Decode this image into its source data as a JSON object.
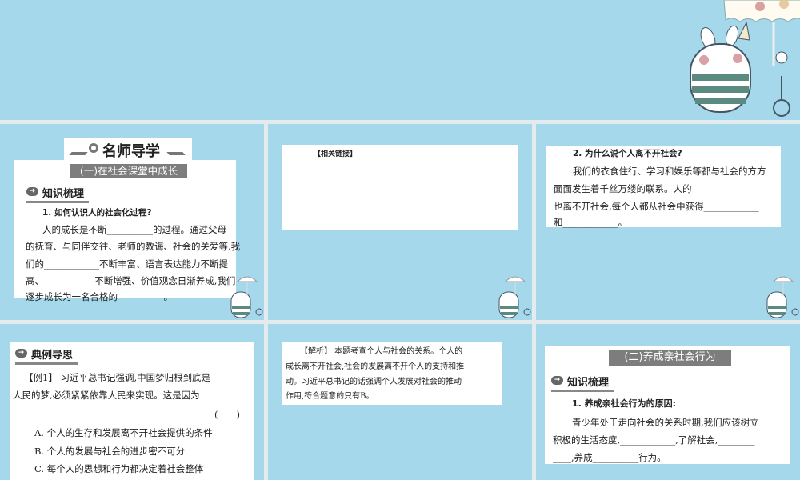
{
  "slide1": {
    "banner": "名师导学",
    "subtitle": "(一)在社会课堂中成长",
    "section": "知识梳理",
    "question": "1. 如何认识人的社会化过程?",
    "lines": [
      "人的成长是不断__________的过程。通过父母",
      "的抚育、与同伴交往、老师的教诲、社会的关爱等,我",
      "们的____________不断丰富、语言表达能力不断提",
      "高、___________不断增强、价值观念日渐养成,我们",
      "逐步成长为一名合格的__________。"
    ]
  },
  "slide2": {
    "label": "【相关链接】"
  },
  "slide3": {
    "question": "2. 为什么说个人离不开社会?",
    "lines": [
      "我们的衣食住行、学习和娱乐等都与社会的方方",
      "面面发生着千丝万缕的联系。人的______________",
      "也离不开社会,每个人都从社会中获得____________",
      "和____________。"
    ]
  },
  "slide4": {
    "section": "典例导思",
    "lines": [
      "【例1】 习近平总书记强调,中国梦归根到底是",
      "人民的梦,必须紧紧依靠人民来实现。这是因为",
      "(　　)"
    ],
    "options": [
      "A. 个人的生存和发展离不开社会提供的条件",
      "B. 个人的发展与社会的进步密不可分",
      "C. 每个人的思想和行为都决定着社会整体"
    ]
  },
  "slide5": {
    "lines": [
      "【解析】 本题考查个人与社会的关系。个人的",
      "成长离不开社会,社会的发展离不开个人的支持和推",
      "动。习近平总书记的话强调个人发展对社会的推动",
      "作用,符合题意的只有B。"
    ]
  },
  "slide6": {
    "subtitle": "(二)养成亲社会行为",
    "section": "知识梳理",
    "question": "1. 养成亲社会行为的原因:",
    "lines": [
      "青少年处于走向社会的关系时期,我们应该树立",
      "积极的生活态度,____________,了解社会,________",
      "____,养成__________行为。"
    ]
  },
  "colors": {
    "bg": "#a6d8ec",
    "separator": "#e3ebee",
    "grey_bar": "#7d7d7d"
  }
}
